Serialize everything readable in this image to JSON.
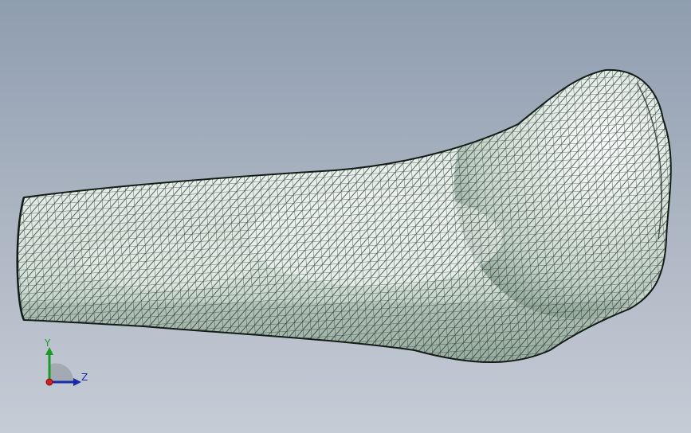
{
  "viewport": {
    "background_top": "#8f9db0",
    "background_bottom": "#c6ccd6",
    "model": {
      "description_icon": "bone-mesh-model",
      "fill_color": "#d4e1da",
      "highlight_color": "#f4f8f6",
      "shadow_color": "#8ea497",
      "wire_color": "#1f2a26"
    }
  },
  "triad": {
    "y_label": "Y",
    "z_label": "Z",
    "y_color": "#1c9a2a",
    "z_color": "#1a2aa8",
    "x_color": "#d22020"
  }
}
